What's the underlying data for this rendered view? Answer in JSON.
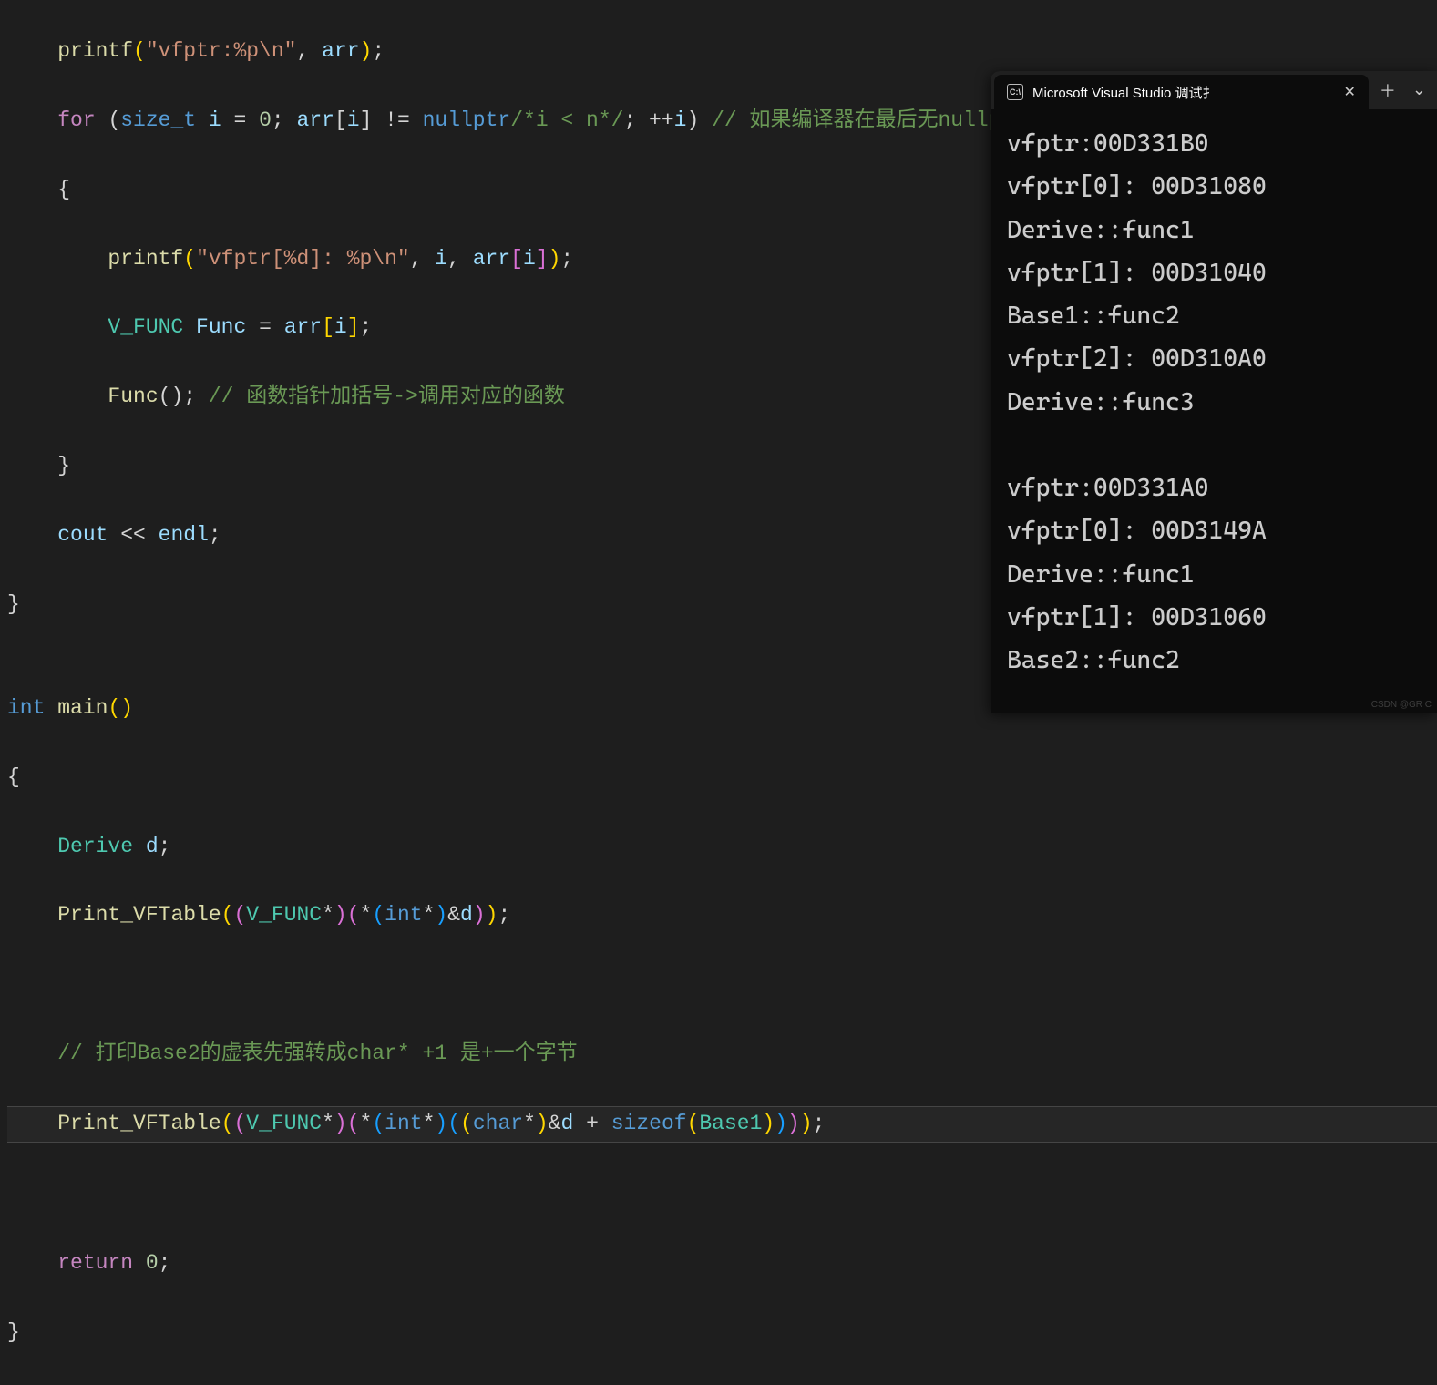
{
  "code": {
    "line0_partial": "    printf(\"vfptr:%p\\n\", arr);",
    "line1": {
      "indent": "    ",
      "for_kw": "for",
      "open": " (",
      "type": "size_t",
      "var": " i",
      "eq": " = ",
      "zero": "0",
      "semi1": "; ",
      "arr": "arr",
      "bracket": "[",
      "i2": "i",
      "bracket2": "] != ",
      "nullptr": "nullptr",
      "comment_inline": "/*i < n*/",
      "semi2": "; ++",
      "i3": "i",
      "close": ") ",
      "comment_end": "// 如果编译器在最后无nullptr，就要手动传参，"
    },
    "line2": "    {",
    "line3": {
      "indent": "        ",
      "printf": "printf",
      "open": "(",
      "str": "\"vfptr[%d]: %p\\n\"",
      "comma": ", ",
      "i": "i",
      "comma2": ", ",
      "arr": "arr",
      "b1": "[",
      "i2": "i",
      "b2": "])",
      "semi": ";"
    },
    "line4": {
      "indent": "        ",
      "type": "V_FUNC",
      "var": " Func",
      "eq": " = ",
      "arr": "arr",
      "b1": "[",
      "i": "i",
      "b2": "]",
      "semi": ";"
    },
    "line5": {
      "indent": "        ",
      "func": "Func",
      "call": "(); ",
      "comment": "// 函数指针加括号->调用对应的函数"
    },
    "line6": "    }",
    "line7": {
      "indent": "    ",
      "cout": "cout",
      "op": " << ",
      "endl": "endl",
      "semi": ";"
    },
    "line8": "}",
    "line9": "",
    "line10": {
      "type": "int",
      "space": " ",
      "main": "main",
      "parens": "()"
    },
    "line11": "{",
    "line12": {
      "indent": "    ",
      "type": "Derive",
      "var": " d",
      "semi": ";"
    },
    "line13": {
      "indent": "    ",
      "func": "Print_VFTable",
      "p1": "((",
      "type1": "V_FUNC",
      "star1": "*)(*(",
      "type2": "int",
      "star2": "*)&",
      "d": "d",
      "close": "));"
    },
    "line14": "",
    "line15": {
      "indent": "    ",
      "comment": "// 打印Base2的虚表先强转成char* +1 是+一个字节"
    },
    "line16": {
      "indent": "    ",
      "func": "Print_VFTable",
      "p1": "((",
      "type1": "V_FUNC",
      "s1": "*)(*(",
      "type2": "int",
      "s2": "*)((",
      "type3": "char",
      "s3": "*)&",
      "d": "d",
      "plus": " + ",
      "sizeof": "sizeof",
      "p2": "(",
      "base1": "Base1",
      "close": "))));"
    },
    "line17": "",
    "line18": {
      "indent": "    ",
      "return": "return",
      "space": " ",
      "zero": "0",
      "semi": ";"
    },
    "line19": "}"
  },
  "console": {
    "tab_title": "Microsoft Visual Studio 调试扌",
    "tab_icon_text": "C:\\",
    "output": [
      "vfptr:00D331B0",
      "vfptr[0]: 00D31080",
      "Derive::func1",
      "vfptr[1]: 00D31040",
      "Base1::func2",
      "vfptr[2]: 00D310A0",
      "Derive::func3",
      "",
      "vfptr:00D331A0",
      "vfptr[0]: 00D3149A",
      "Derive::func1",
      "vfptr[1]: 00D31060",
      "Base2::func2"
    ]
  },
  "watermark": "CSDN @GR C"
}
